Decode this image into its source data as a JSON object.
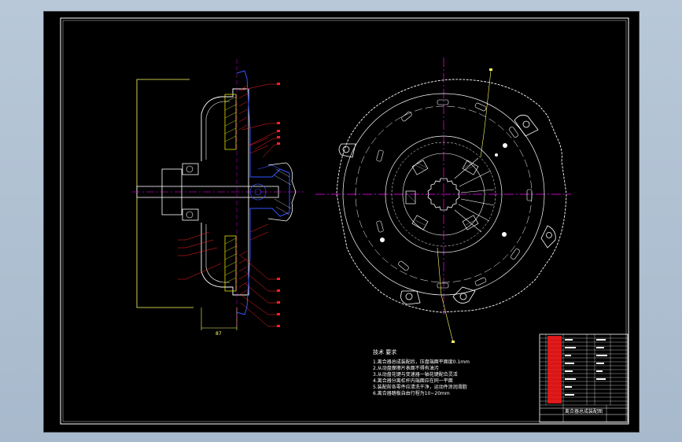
{
  "drawing": {
    "dimension_label": "87",
    "tech_notes": {
      "title": "技术 要求",
      "lines": [
        "1.离合器总成装配后，压盘端面平面度0.1mm",
        "2.从动盘摩擦片表面不得有油污",
        "3.从动盘花键与变速器一轴花键配合灵活",
        "4.离合器分离杠杆内端面应在同一平面",
        "5.装配前各零件应清洗干净，运动件涂润滑脂",
        "6.离合器踏板自由行程为10~20mm"
      ]
    },
    "title_block": {
      "drawing_name": "离合器总成装配图"
    },
    "colors": {
      "sheet": "#000000",
      "frame": "#ffffff",
      "outline": "#ffff66",
      "center_line": "#ff00ff",
      "blue": "#3355ff",
      "red": "#ff2222",
      "section": "#ffff00"
    }
  }
}
